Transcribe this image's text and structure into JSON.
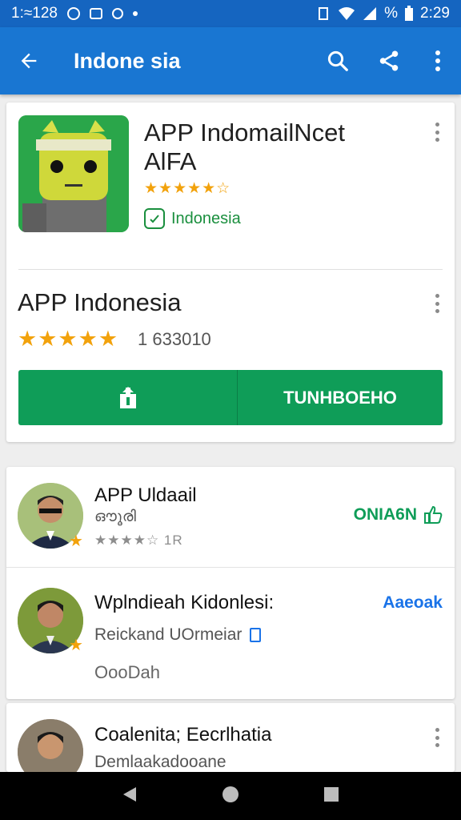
{
  "status_bar": {
    "time_left": "1:≈128",
    "time_right": "2:29",
    "battery": "%"
  },
  "app_bar": {
    "title": "Indone sia"
  },
  "app_card": {
    "title_line1": "APP IndomailNcet",
    "title_line2": "AlFA",
    "stars": "★★★★★☆",
    "country": "Indonesia"
  },
  "detail": {
    "title": "APP Indonesia",
    "stars": "★★★★★",
    "rating_count": "1  633010",
    "action_label": "TUNHBOEHO"
  },
  "list": [
    {
      "name": "APP Uldaail",
      "sub": "ഔൂരി",
      "stars": "★★★★☆ 1R",
      "action": "ONIA6N"
    },
    {
      "name": "Wplndieah Kidonlesi:",
      "sub": "Reickand UOrmeiar",
      "extra": "OooDah",
      "action": "Aaeoak"
    },
    {
      "name": "Coalenita; Eecrlhatia",
      "sub": "Demlaakadooane"
    }
  ],
  "colors": {
    "primary": "#1976d2",
    "status": "#1565c0",
    "green": "#0f9d58",
    "star": "#f2a20c",
    "link_blue": "#1a73e8"
  }
}
